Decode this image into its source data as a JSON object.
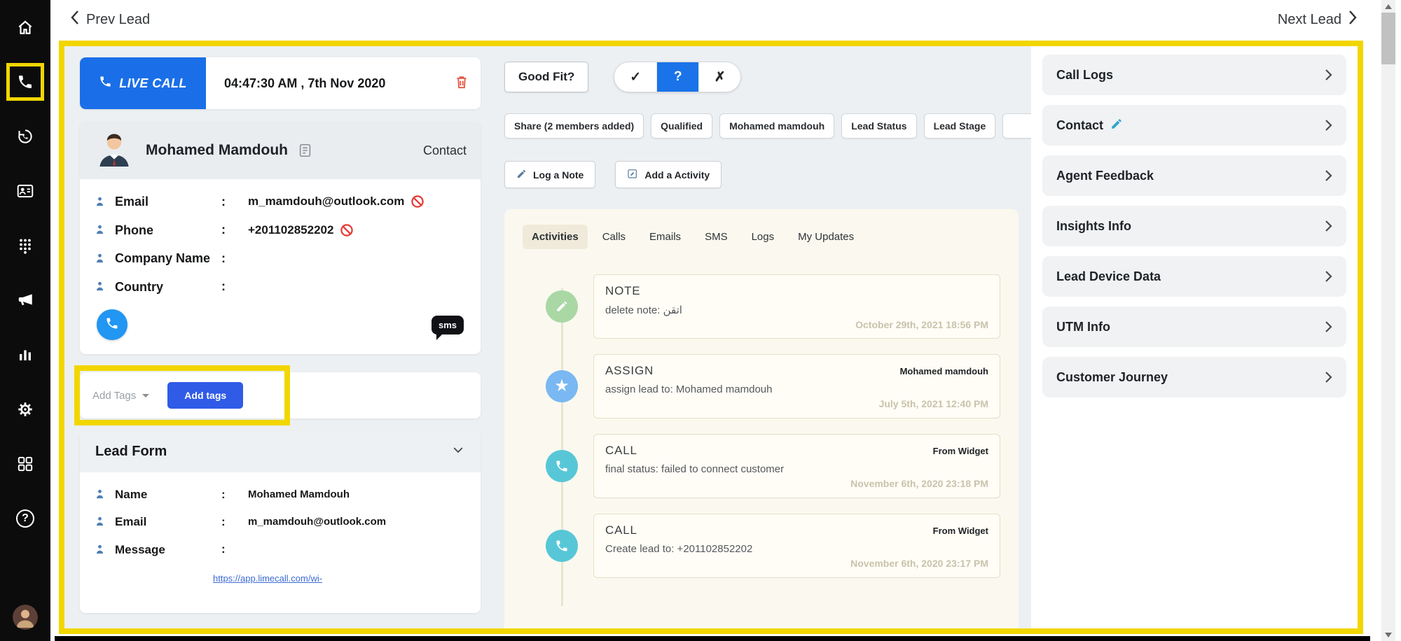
{
  "ui": {
    "colon": ":",
    "help_glyph": "?",
    "star_glyph": "★"
  },
  "colors": {
    "highlight_yellow": "#F2D600",
    "live_call_blue": "#1A6FE8",
    "add_tags_blue": "#2F5BE7",
    "selected_segment_blue": "#1A73E8",
    "call_button_blue": "#2196F3",
    "note_green": "#A9D8A5",
    "assign_blue": "#79B8F2",
    "call_teal": "#57C7D7",
    "danger_red": "#E53935"
  },
  "topbar": {
    "prev_label": "Prev Lead",
    "next_label": "Next Lead"
  },
  "live_call": {
    "label": "LIVE CALL",
    "datetime": "04:47:30 AM , 7th Nov 2020"
  },
  "contact_card": {
    "name": "Mohamed Mamdouh",
    "type_label": "Contact",
    "sms_label": "sms",
    "fields": [
      {
        "label": "Email",
        "value": "m_mamdouh@outlook.com",
        "blocked": true
      },
      {
        "label": "Phone",
        "value": "+201102852202",
        "blocked": true
      },
      {
        "label": "Company Name",
        "value": ""
      },
      {
        "label": "Country",
        "value": ""
      }
    ]
  },
  "tags": {
    "placeholder": "Add Tags",
    "button_label": "Add tags"
  },
  "lead_form": {
    "title": "Lead Form",
    "fields": [
      {
        "label": "Name",
        "value": "Mohamed Mamdouh"
      },
      {
        "label": "Email",
        "value": "m_mamdouh@outlook.com"
      },
      {
        "label": "Message",
        "value": ""
      }
    ],
    "link": "https://app.limecall.com/wi-"
  },
  "qualify": {
    "good_fit_label": "Good Fit?",
    "options": [
      {
        "glyph": "✓",
        "name": "good",
        "selected": false
      },
      {
        "glyph": "?",
        "name": "unsure",
        "selected": true
      },
      {
        "glyph": "✗",
        "name": "bad",
        "selected": false
      }
    ]
  },
  "chips": {
    "items": [
      {
        "label": "Share (2 members added)"
      },
      {
        "label": "Qualified"
      },
      {
        "label": "Mohamed mamdouh"
      },
      {
        "label": "Lead Status"
      },
      {
        "label": "Lead Stage"
      },
      {
        "label": ""
      }
    ]
  },
  "note_actions": {
    "log_note": "Log a Note",
    "add_activity": "Add a Activity"
  },
  "tabs": {
    "items": [
      {
        "label": "Activities",
        "active": true
      },
      {
        "label": "Calls",
        "active": false
      },
      {
        "label": "Emails",
        "active": false
      },
      {
        "label": "SMS",
        "active": false
      },
      {
        "label": "Logs",
        "active": false
      },
      {
        "label": "My Updates",
        "active": false
      }
    ]
  },
  "timeline": {
    "items": [
      {
        "type": "NOTE",
        "icon": "note-pencil-icon",
        "message": "delete note: اتقن",
        "source": "",
        "timestamp": "October 29th, 2021 18:56 PM"
      },
      {
        "type": "ASSIGN",
        "icon": "star-icon",
        "message": "assign lead to: Mohamed mamdouh",
        "source": "Mohamed mamdouh",
        "timestamp": "July 5th, 2021 12:40 PM"
      },
      {
        "type": "CALL",
        "icon": "phone-icon",
        "message": "final status: failed to connect customer",
        "source": "From Widget",
        "timestamp": "November 6th, 2020 23:18 PM"
      },
      {
        "type": "CALL",
        "icon": "phone-icon",
        "message": "Create lead to: +201102852202",
        "source": "From Widget",
        "timestamp": "November 6th, 2020 23:17 PM"
      }
    ]
  },
  "right_panel": {
    "items": [
      {
        "label": "Call Logs",
        "editable": false
      },
      {
        "label": "Contact",
        "editable": true
      },
      {
        "label": "Agent Feedback",
        "editable": false
      },
      {
        "label": "Insights Info",
        "editable": false
      },
      {
        "label": "Lead Device Data",
        "editable": false
      },
      {
        "label": "UTM Info",
        "editable": false
      },
      {
        "label": "Customer Journey",
        "editable": false
      }
    ]
  }
}
